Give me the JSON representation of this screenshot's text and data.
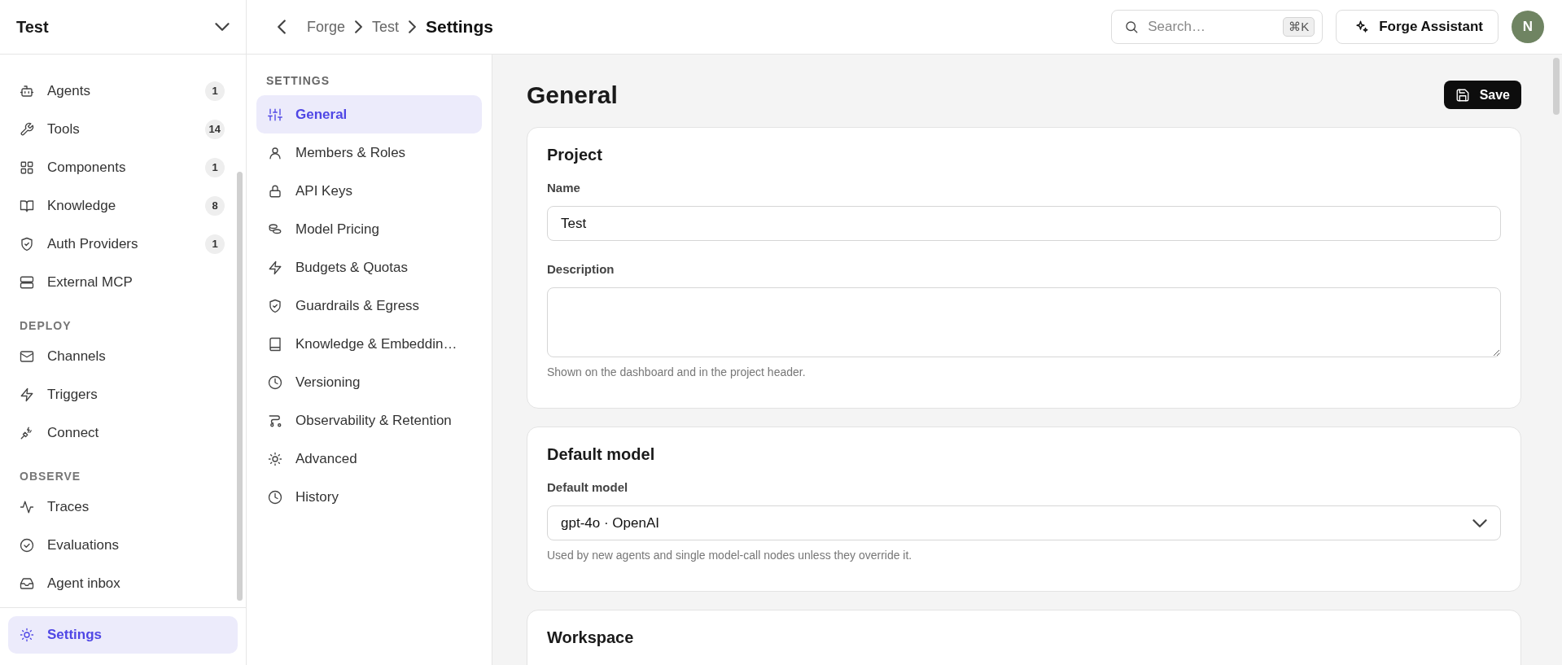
{
  "sidebar": {
    "project": "Test",
    "groups": [
      {
        "items": [
          {
            "label": "Agents",
            "badge": "1",
            "selected": false
          },
          {
            "label": "Tools",
            "badge": "14",
            "selected": false
          },
          {
            "label": "Components",
            "badge": "1",
            "selected": false
          },
          {
            "label": "Knowledge",
            "badge": "8",
            "selected": false
          },
          {
            "label": "Auth Providers",
            "badge": "1",
            "selected": false
          },
          {
            "label": "External MCP",
            "selected": false
          }
        ]
      },
      {
        "heading": "DEPLOY",
        "items": [
          {
            "label": "Channels",
            "selected": false
          },
          {
            "label": "Triggers",
            "selected": false
          },
          {
            "label": "Connect",
            "selected": false
          }
        ]
      },
      {
        "heading": "OBSERVE",
        "items": [
          {
            "label": "Traces",
            "selected": false
          },
          {
            "label": "Evaluations",
            "selected": false
          },
          {
            "label": "Agent inbox",
            "selected": false
          }
        ]
      }
    ],
    "footer_item": {
      "label": "Settings",
      "selected": true
    }
  },
  "topbar": {
    "breadcrumb": [
      "Forge",
      "Test",
      "Settings"
    ],
    "search": {
      "placeholder": "Search…",
      "shortcut": "⌘K"
    },
    "assistant_button": "Forge Assistant",
    "avatar": "N"
  },
  "settings_nav": {
    "heading": "SETTINGS",
    "items": [
      {
        "label": "General",
        "selected": true
      },
      {
        "label": "Members & Roles",
        "selected": false
      },
      {
        "label": "API Keys",
        "selected": false
      },
      {
        "label": "Model Pricing",
        "selected": false
      },
      {
        "label": "Budgets & Quotas",
        "selected": false
      },
      {
        "label": "Guardrails & Egress",
        "selected": false
      },
      {
        "label": "Knowledge & Embeddin…",
        "selected": false
      },
      {
        "label": "Versioning",
        "selected": false
      },
      {
        "label": "Observability & Retention",
        "selected": false
      },
      {
        "label": "Advanced",
        "selected": false
      },
      {
        "label": "History",
        "selected": false
      }
    ]
  },
  "page": {
    "title": "General",
    "save_button": "Save",
    "cards": [
      {
        "title": "Project",
        "fields": [
          {
            "kind": "text",
            "label": "Name",
            "value": "Test"
          },
          {
            "kind": "textarea",
            "label": "Description",
            "help": "Shown on the dashboard and in the project header."
          }
        ]
      },
      {
        "title": "Default model",
        "fields": [
          {
            "kind": "select",
            "label": "Default model",
            "value": "gpt-4o · OpenAI",
            "help": "Used by new agents and single model-call nodes unless they override it."
          }
        ]
      },
      {
        "title": "Workspace"
      }
    ]
  }
}
